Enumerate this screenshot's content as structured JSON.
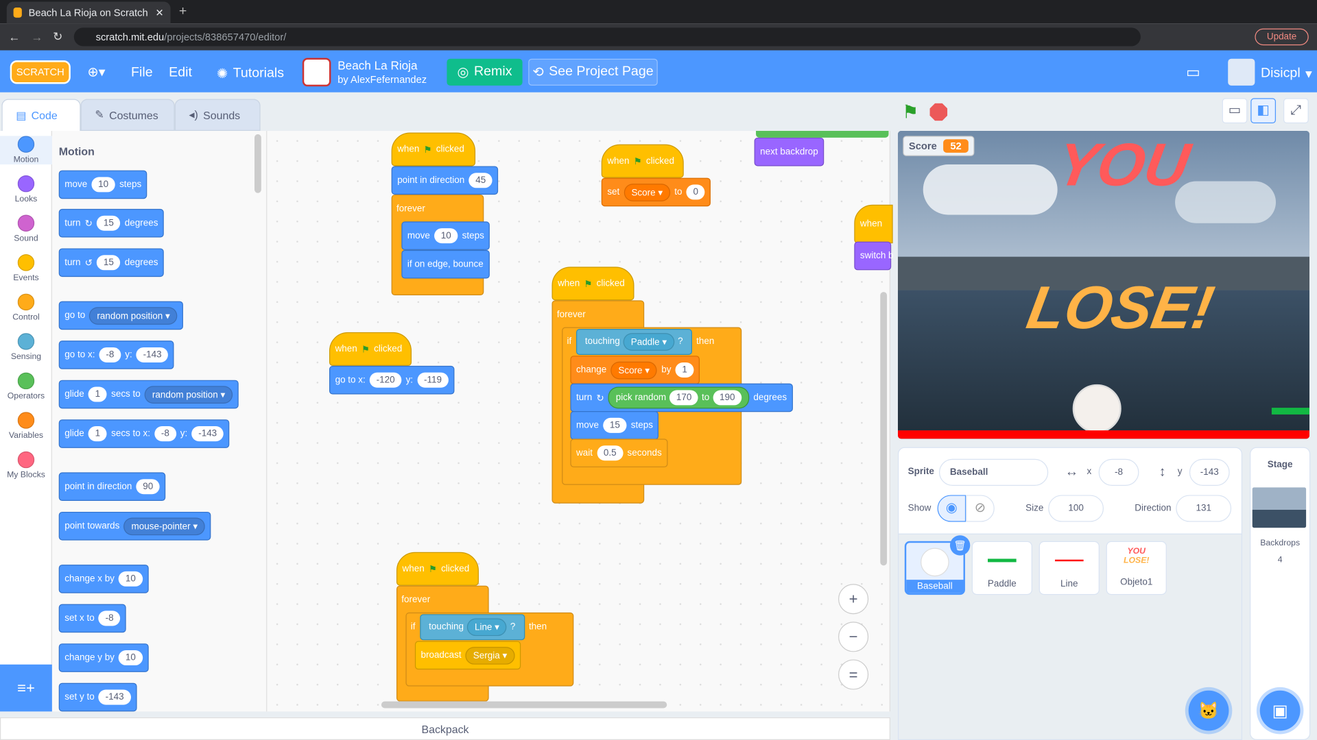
{
  "browser": {
    "tab_title": "Beach La Rioja on Scratch",
    "url_host": "scratch.mit.edu",
    "url_path": "/projects/838657470/editor/",
    "update": "Update"
  },
  "menubar": {
    "logo": "SCRATCH",
    "file": "File",
    "edit": "Edit",
    "tutorials": "Tutorials",
    "project_title": "Beach La Rioja",
    "author": "by AlexFefernandez",
    "remix": "Remix",
    "see_project": "See Project Page",
    "user": "Disicpl"
  },
  "tabs": {
    "code": "Code",
    "costumes": "Costumes",
    "sounds": "Sounds"
  },
  "categories": [
    {
      "label": "Motion",
      "color": "#4c97ff"
    },
    {
      "label": "Looks",
      "color": "#9966ff"
    },
    {
      "label": "Sound",
      "color": "#cf63cf"
    },
    {
      "label": "Events",
      "color": "#ffbf00"
    },
    {
      "label": "Control",
      "color": "#ffab19"
    },
    {
      "label": "Sensing",
      "color": "#5cb1d6"
    },
    {
      "label": "Operators",
      "color": "#59c059"
    },
    {
      "label": "Variables",
      "color": "#ff8c1a"
    },
    {
      "label": "My Blocks",
      "color": "#ff6680"
    }
  ],
  "palette": {
    "title": "Motion",
    "move": "move",
    "steps": "steps",
    "v10": "10",
    "turn": "turn",
    "degrees": "degrees",
    "v15": "15",
    "goto": "go to",
    "random_position": "random position",
    "gotox": "go to x:",
    "y": "y:",
    "xv": "-8",
    "yv": "-143",
    "glide": "glide",
    "v1": "1",
    "secs_to": "secs to",
    "secs_to_x": "secs to x:",
    "point_dir": "point in direction",
    "v90": "90",
    "point_towards": "point towards",
    "mouse": "mouse-pointer",
    "change_x": "change x by",
    "set_x": "set x to",
    "change_y": "change y by",
    "set_y": "set y to"
  },
  "script": {
    "when": "when",
    "clicked": "clicked",
    "point_dir": "point in direction",
    "v45": "45",
    "forever": "forever",
    "move": "move",
    "steps": "steps",
    "v10": "10",
    "bounce": "if on edge, bounce",
    "set": "set",
    "score": "Score",
    "to": "to",
    "v0": "0",
    "next_backdrop": "next backdrop",
    "switch": "switch b",
    "if": "if",
    "touching": "touching",
    "paddle": "Paddle",
    "q": "?",
    "then": "then",
    "change": "change",
    "by": "by",
    "v1": "1",
    "turn": "turn",
    "pick_random": "pick random",
    "v170": "170",
    "v190": "190",
    "degrees": "degrees",
    "v15": "15",
    "wait": "wait",
    "v05": "0.5",
    "seconds": "seconds",
    "gotox": "go to x:",
    "x120": "-120",
    "y": "y:",
    "y119": "-119",
    "line": "Line",
    "broadcast": "broadcast",
    "sergia": "Sergia",
    "zoom_in": "+",
    "zoom_out": "−",
    "zoom_reset": "="
  },
  "stage": {
    "score_label": "Score",
    "score_value": "52",
    "you": "YOU",
    "lose": "LOSE!"
  },
  "sprite_info": {
    "sprite_label": "Sprite",
    "sprite_name": "Baseball",
    "x_label": "x",
    "x": "-8",
    "y_label": "y",
    "y": "-143",
    "show": "Show",
    "size_label": "Size",
    "size": "100",
    "direction_label": "Direction",
    "direction": "131"
  },
  "sprites": [
    {
      "name": "Baseball"
    },
    {
      "name": "Paddle"
    },
    {
      "name": "Line"
    },
    {
      "name": "Objeto1"
    }
  ],
  "stage_panel": {
    "title": "Stage",
    "backdrops": "Backdrops",
    "count": "4"
  },
  "backpack": "Backpack"
}
